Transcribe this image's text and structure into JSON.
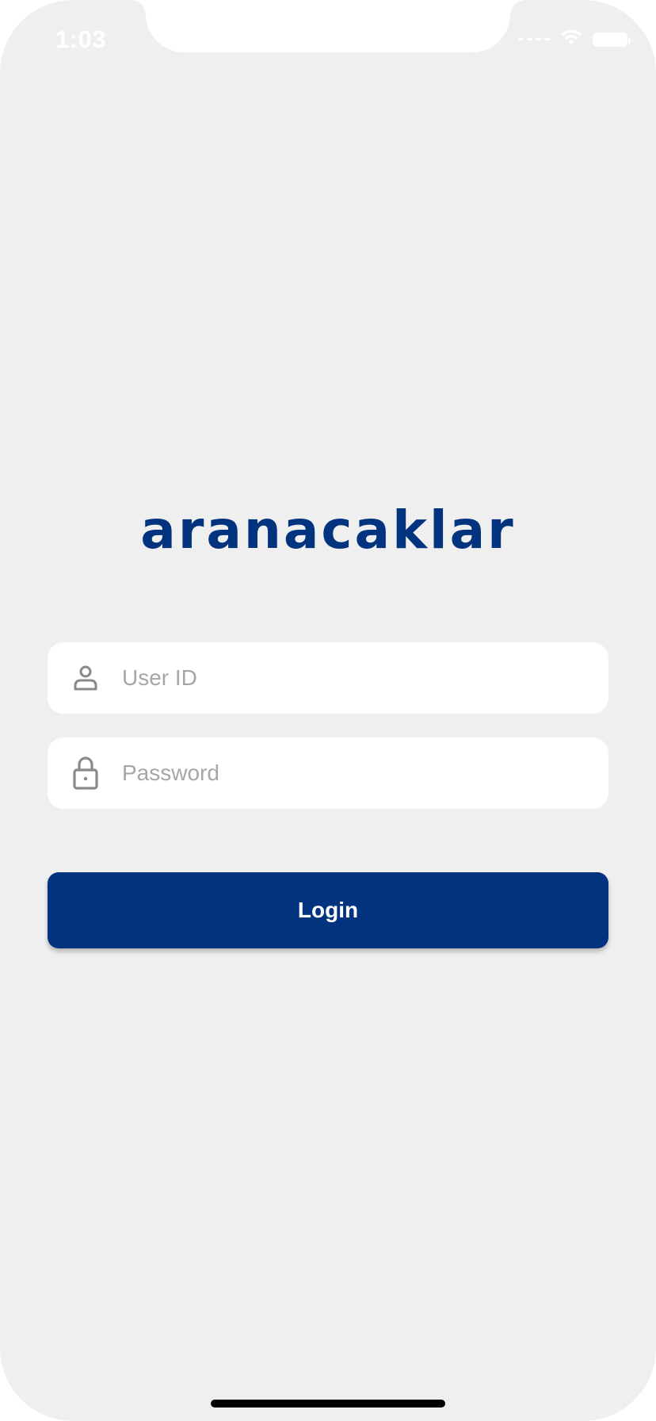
{
  "status_bar": {
    "time": "1:03",
    "wifi_icon": "wifi-icon",
    "battery_icon": "battery-icon"
  },
  "brand": {
    "logo_text": "aranacaklar",
    "color": "#02337f"
  },
  "login_form": {
    "user_id": {
      "icon": "user-icon",
      "placeholder": "User ID",
      "value": ""
    },
    "password": {
      "icon": "lock-icon",
      "placeholder": "Password",
      "value": ""
    },
    "submit_label": "Login"
  },
  "colors": {
    "background": "#efefef",
    "accent": "#02337f",
    "field_background": "#ffffff",
    "placeholder": "#a6a6a6"
  }
}
